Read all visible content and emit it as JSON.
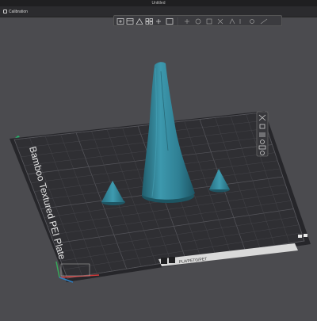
{
  "window": {
    "title": "Untitled"
  },
  "tabs": [
    {
      "label": "Calibration"
    }
  ],
  "plate": {
    "name": "Bamboo Textured PEI Plate",
    "filament_label": "PLA/PETG/PET"
  },
  "toolbar_icons": [
    "add-icon",
    "add-plate-icon",
    "orient-icon",
    "arrange-icon",
    "split-icon",
    "layout-icon",
    "move-icon",
    "rotate-icon",
    "scale-icon",
    "cut-icon",
    "support-paint-icon",
    "seam-icon",
    "color-paint-icon",
    "measure-icon"
  ],
  "side_toolbar_icons": [
    "close-icon",
    "lock-icon",
    "list-icon",
    "settings-icon",
    "bed-icon",
    "target-icon"
  ],
  "colors": {
    "background": "#4b4b4f",
    "plate": "#2f2f33",
    "model": "#3a93a8",
    "accent": "#1fb86b"
  }
}
